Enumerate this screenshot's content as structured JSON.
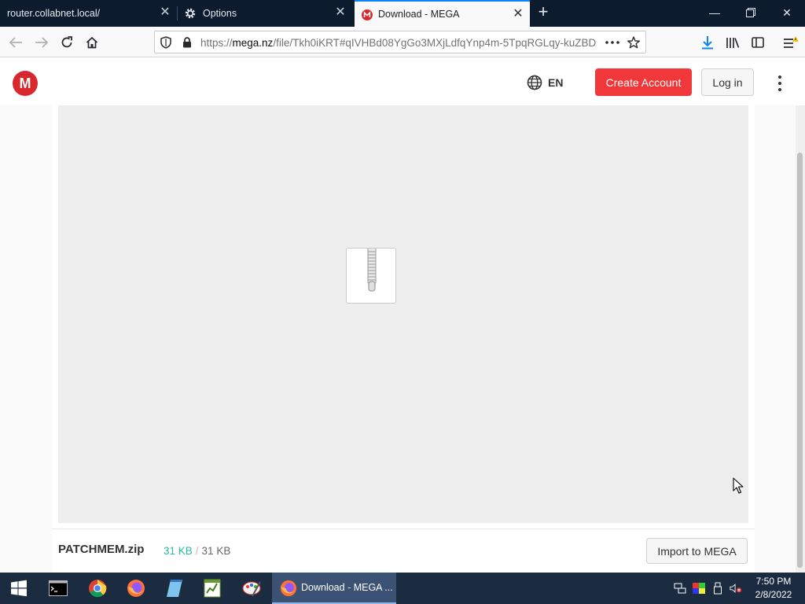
{
  "browser": {
    "tabs": [
      {
        "label": "router.collabnet.local/"
      },
      {
        "label": "Options"
      },
      {
        "label": "Download - MEGA"
      }
    ],
    "url_prefix": "https://",
    "url_domain": "mega.nz",
    "url_path": "/file/Tkh0iKRT#qIVHBd08YgGo3MXjLdfqYnp4m-5TpqRGLqy-kuZBD",
    "accent_color": "#0a84ff"
  },
  "site": {
    "logo_letter": "M",
    "language": "EN",
    "create_account_label": "Create Account",
    "login_label": "Log in",
    "brand_color": "#d9272e"
  },
  "file": {
    "name": "PATCHMEM.zip",
    "downloaded": "31 KB",
    "separator": "/",
    "total": "31 KB",
    "import_label": "Import to MEGA"
  },
  "taskbar": {
    "active_task_label": "Download - MEGA ...",
    "time": "7:50 PM",
    "date": "2/8/2022"
  }
}
